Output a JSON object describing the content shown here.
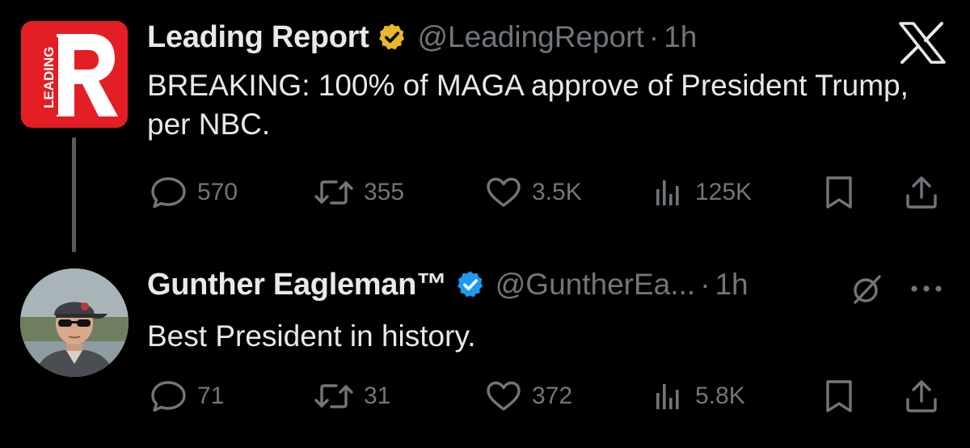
{
  "posts": [
    {
      "author": "Leading Report",
      "handle": "@LeadingReport",
      "separator": "·",
      "time": "1h",
      "verified_type": "gold",
      "text": "BREAKING: 100% of MAGA approve of President Trump, per NBC.",
      "avatar_text": "LEADING",
      "avatar_letter": "R",
      "stats": {
        "replies": "570",
        "reposts": "355",
        "likes": "3.5K",
        "views": "125K"
      }
    },
    {
      "author": "Gunther Eagleman™",
      "handle": "@GuntherEa...",
      "separator": "·",
      "time": "1h",
      "verified_type": "blue",
      "text": "Best President in history.",
      "stats": {
        "replies": "71",
        "reposts": "31",
        "likes": "372",
        "views": "5.8K"
      }
    }
  ],
  "icons": {
    "app_logo": "x-logo-icon",
    "reply": "reply-bubble-icon",
    "repost": "repost-icon",
    "like": "heart-icon",
    "views": "views-bar-icon",
    "bookmark": "bookmark-icon",
    "share": "share-icon",
    "grok": "grok-icon",
    "more": "more-dots-icon"
  },
  "colors": {
    "background": "#000000",
    "text_primary": "#e7e9ea",
    "text_secondary": "#71767b",
    "verified_gold": "#e8b829",
    "verified_blue": "#1d9bf0",
    "brand_red": "#e31e24",
    "thread_line": "#555b61"
  }
}
